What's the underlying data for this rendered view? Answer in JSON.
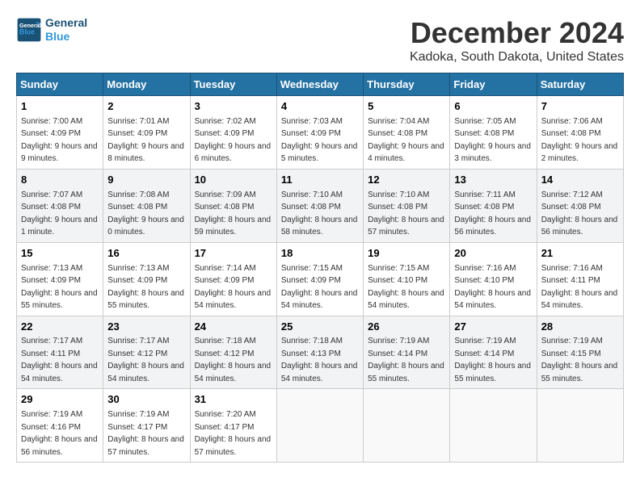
{
  "header": {
    "logo_line1": "General",
    "logo_line2": "Blue",
    "month": "December 2024",
    "location": "Kadoka, South Dakota, United States"
  },
  "weekdays": [
    "Sunday",
    "Monday",
    "Tuesday",
    "Wednesday",
    "Thursday",
    "Friday",
    "Saturday"
  ],
  "weeks": [
    [
      {
        "day": "1",
        "sunrise": "7:00 AM",
        "sunset": "4:09 PM",
        "daylight": "9 hours and 9 minutes."
      },
      {
        "day": "2",
        "sunrise": "7:01 AM",
        "sunset": "4:09 PM",
        "daylight": "9 hours and 8 minutes."
      },
      {
        "day": "3",
        "sunrise": "7:02 AM",
        "sunset": "4:09 PM",
        "daylight": "9 hours and 6 minutes."
      },
      {
        "day": "4",
        "sunrise": "7:03 AM",
        "sunset": "4:09 PM",
        "daylight": "9 hours and 5 minutes."
      },
      {
        "day": "5",
        "sunrise": "7:04 AM",
        "sunset": "4:08 PM",
        "daylight": "9 hours and 4 minutes."
      },
      {
        "day": "6",
        "sunrise": "7:05 AM",
        "sunset": "4:08 PM",
        "daylight": "9 hours and 3 minutes."
      },
      {
        "day": "7",
        "sunrise": "7:06 AM",
        "sunset": "4:08 PM",
        "daylight": "9 hours and 2 minutes."
      }
    ],
    [
      {
        "day": "8",
        "sunrise": "7:07 AM",
        "sunset": "4:08 PM",
        "daylight": "9 hours and 1 minute."
      },
      {
        "day": "9",
        "sunrise": "7:08 AM",
        "sunset": "4:08 PM",
        "daylight": "9 hours and 0 minutes."
      },
      {
        "day": "10",
        "sunrise": "7:09 AM",
        "sunset": "4:08 PM",
        "daylight": "8 hours and 59 minutes."
      },
      {
        "day": "11",
        "sunrise": "7:10 AM",
        "sunset": "4:08 PM",
        "daylight": "8 hours and 58 minutes."
      },
      {
        "day": "12",
        "sunrise": "7:10 AM",
        "sunset": "4:08 PM",
        "daylight": "8 hours and 57 minutes."
      },
      {
        "day": "13",
        "sunrise": "7:11 AM",
        "sunset": "4:08 PM",
        "daylight": "8 hours and 56 minutes."
      },
      {
        "day": "14",
        "sunrise": "7:12 AM",
        "sunset": "4:08 PM",
        "daylight": "8 hours and 56 minutes."
      }
    ],
    [
      {
        "day": "15",
        "sunrise": "7:13 AM",
        "sunset": "4:09 PM",
        "daylight": "8 hours and 55 minutes."
      },
      {
        "day": "16",
        "sunrise": "7:13 AM",
        "sunset": "4:09 PM",
        "daylight": "8 hours and 55 minutes."
      },
      {
        "day": "17",
        "sunrise": "7:14 AM",
        "sunset": "4:09 PM",
        "daylight": "8 hours and 54 minutes."
      },
      {
        "day": "18",
        "sunrise": "7:15 AM",
        "sunset": "4:09 PM",
        "daylight": "8 hours and 54 minutes."
      },
      {
        "day": "19",
        "sunrise": "7:15 AM",
        "sunset": "4:10 PM",
        "daylight": "8 hours and 54 minutes."
      },
      {
        "day": "20",
        "sunrise": "7:16 AM",
        "sunset": "4:10 PM",
        "daylight": "8 hours and 54 minutes."
      },
      {
        "day": "21",
        "sunrise": "7:16 AM",
        "sunset": "4:11 PM",
        "daylight": "8 hours and 54 minutes."
      }
    ],
    [
      {
        "day": "22",
        "sunrise": "7:17 AM",
        "sunset": "4:11 PM",
        "daylight": "8 hours and 54 minutes."
      },
      {
        "day": "23",
        "sunrise": "7:17 AM",
        "sunset": "4:12 PM",
        "daylight": "8 hours and 54 minutes."
      },
      {
        "day": "24",
        "sunrise": "7:18 AM",
        "sunset": "4:12 PM",
        "daylight": "8 hours and 54 minutes."
      },
      {
        "day": "25",
        "sunrise": "7:18 AM",
        "sunset": "4:13 PM",
        "daylight": "8 hours and 54 minutes."
      },
      {
        "day": "26",
        "sunrise": "7:19 AM",
        "sunset": "4:14 PM",
        "daylight": "8 hours and 55 minutes."
      },
      {
        "day": "27",
        "sunrise": "7:19 AM",
        "sunset": "4:14 PM",
        "daylight": "8 hours and 55 minutes."
      },
      {
        "day": "28",
        "sunrise": "7:19 AM",
        "sunset": "4:15 PM",
        "daylight": "8 hours and 55 minutes."
      }
    ],
    [
      {
        "day": "29",
        "sunrise": "7:19 AM",
        "sunset": "4:16 PM",
        "daylight": "8 hours and 56 minutes."
      },
      {
        "day": "30",
        "sunrise": "7:19 AM",
        "sunset": "4:17 PM",
        "daylight": "8 hours and 57 minutes."
      },
      {
        "day": "31",
        "sunrise": "7:20 AM",
        "sunset": "4:17 PM",
        "daylight": "8 hours and 57 minutes."
      },
      null,
      null,
      null,
      null
    ]
  ],
  "labels": {
    "sunrise": "Sunrise:",
    "sunset": "Sunset:",
    "daylight": "Daylight:"
  }
}
